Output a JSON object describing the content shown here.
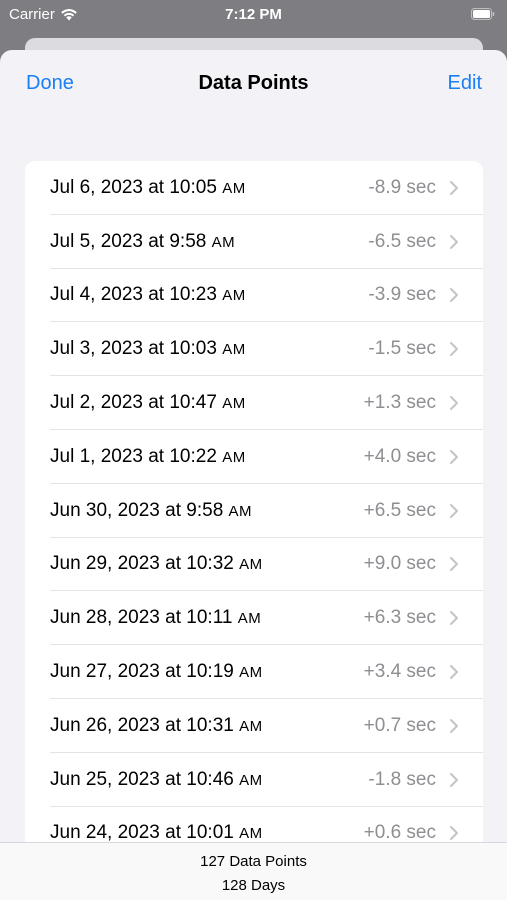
{
  "status_bar": {
    "carrier": "Carrier",
    "time": "7:12 PM"
  },
  "nav": {
    "done_label": "Done",
    "title": "Data Points",
    "edit_label": "Edit"
  },
  "accent_color": "#1a7ff5",
  "rows": [
    {
      "date": "Jul 6, 2023 at 10:05",
      "ampm": "AM",
      "offset": "-8.9 sec"
    },
    {
      "date": "Jul 5, 2023 at 9:58",
      "ampm": "AM",
      "offset": "-6.5 sec"
    },
    {
      "date": "Jul 4, 2023 at 10:23",
      "ampm": "AM",
      "offset": "-3.9 sec"
    },
    {
      "date": "Jul 3, 2023 at 10:03",
      "ampm": "AM",
      "offset": "-1.5 sec"
    },
    {
      "date": "Jul 2, 2023 at 10:47",
      "ampm": "AM",
      "offset": "+1.3 sec"
    },
    {
      "date": "Jul 1, 2023 at 10:22",
      "ampm": "AM",
      "offset": "+4.0 sec"
    },
    {
      "date": "Jun 30, 2023 at 9:58",
      "ampm": "AM",
      "offset": "+6.5 sec"
    },
    {
      "date": "Jun 29, 2023 at 10:32",
      "ampm": "AM",
      "offset": "+9.0 sec"
    },
    {
      "date": "Jun 28, 2023 at 10:11",
      "ampm": "AM",
      "offset": "+6.3 sec"
    },
    {
      "date": "Jun 27, 2023 at 10:19",
      "ampm": "AM",
      "offset": "+3.4 sec"
    },
    {
      "date": "Jun 26, 2023 at 10:31",
      "ampm": "AM",
      "offset": "+0.7 sec"
    },
    {
      "date": "Jun 25, 2023 at 10:46",
      "ampm": "AM",
      "offset": "-1.8 sec"
    },
    {
      "date": "Jun 24, 2023 at 10:01",
      "ampm": "AM",
      "offset": "+0.6 sec"
    }
  ],
  "footer": {
    "count": "127 Data Points",
    "days": "128 Days"
  }
}
